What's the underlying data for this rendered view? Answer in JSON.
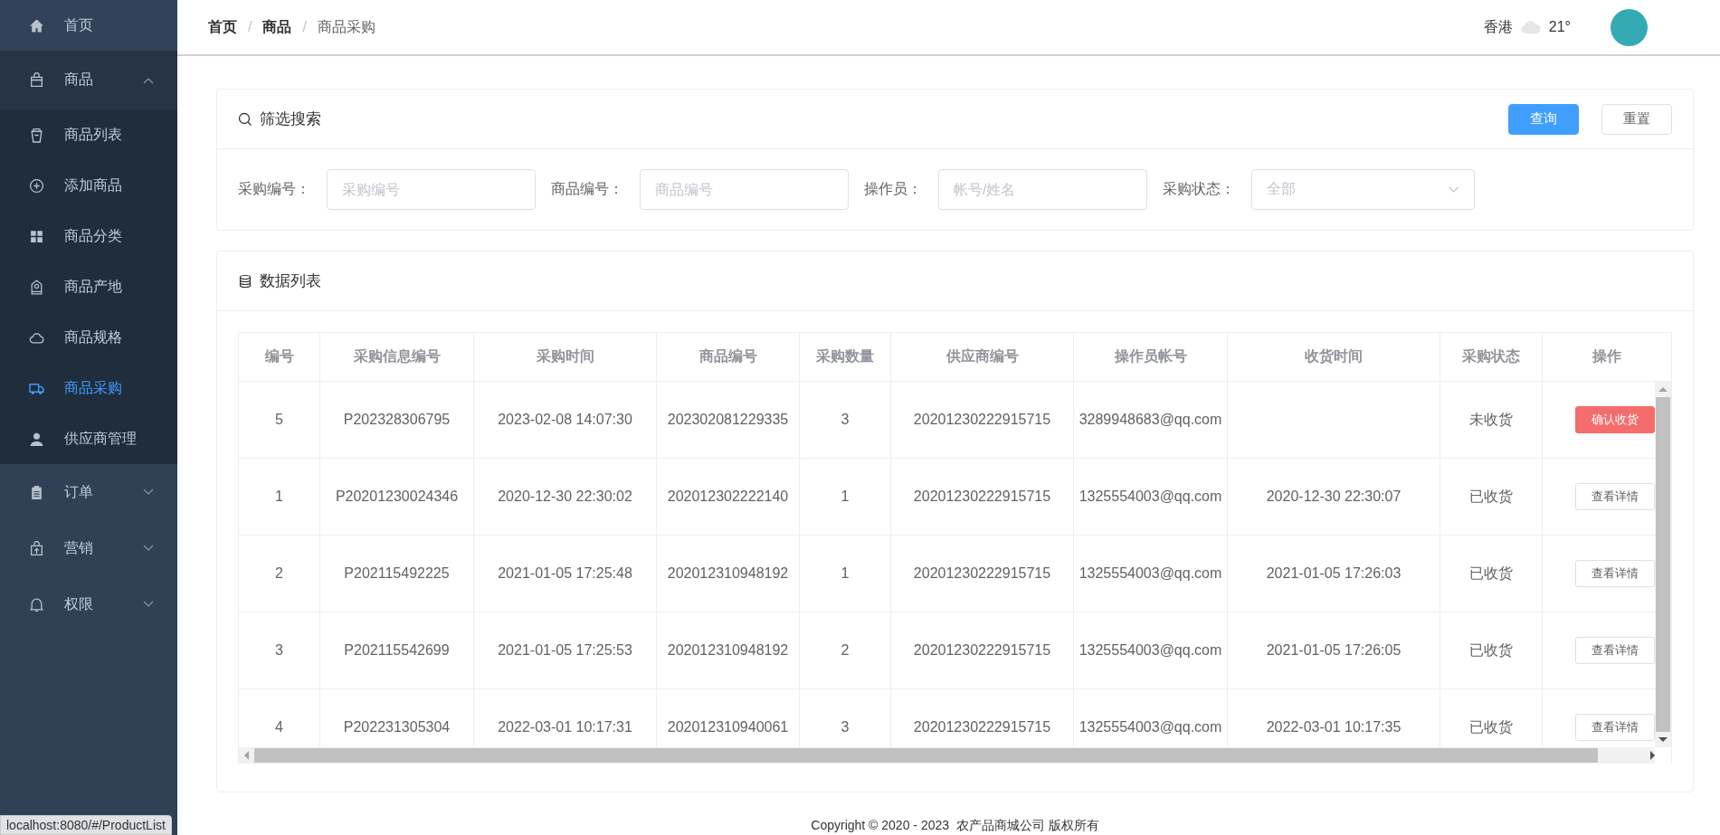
{
  "sidebar": {
    "items": [
      {
        "label": "首页",
        "selected": false
      },
      {
        "label": "商品",
        "expanded": true,
        "selected": false,
        "children": [
          {
            "label": "商品列表",
            "selected": false
          },
          {
            "label": "添加商品",
            "selected": false
          },
          {
            "label": "商品分类",
            "selected": false
          },
          {
            "label": "商品产地",
            "selected": false
          },
          {
            "label": "商品规格",
            "selected": false
          },
          {
            "label": "商品采购",
            "selected": true
          },
          {
            "label": "供应商管理",
            "selected": false
          }
        ]
      },
      {
        "label": "订单",
        "expanded": false,
        "selected": false
      },
      {
        "label": "营销",
        "expanded": false,
        "selected": false
      },
      {
        "label": "权限",
        "expanded": false,
        "selected": false
      }
    ]
  },
  "header": {
    "breadcrumb": [
      "首页",
      "商品",
      "商品采购"
    ],
    "separator": "/",
    "city": "香港",
    "temperature": "21°"
  },
  "filter": {
    "title": "筛选搜索",
    "buttons": [
      {
        "label": "查询",
        "kind": "primary"
      },
      {
        "label": "重置",
        "kind": "plain"
      }
    ],
    "fields": [
      {
        "label": "采购编号：",
        "placeholder": "采购编号",
        "kind": "input"
      },
      {
        "label": "商品编号：",
        "placeholder": "商品编号",
        "kind": "input"
      },
      {
        "label": "操作员：",
        "placeholder": "帐号/姓名",
        "kind": "input"
      },
      {
        "label": "采购状态：",
        "placeholder": "全部",
        "kind": "select"
      }
    ]
  },
  "list": {
    "title": "数据列表",
    "table": {
      "columns": [
        "编号",
        "采购信息编号",
        "采购时间",
        "商品编号",
        "采购数量",
        "供应商编号",
        "操作员帐号",
        "收货时间",
        "采购状态",
        "操作"
      ],
      "rows": [
        {
          "cells": [
            "5",
            "P202328306795",
            "2023-02-08 14:07:30",
            "202302081229335",
            "3",
            "20201230222915715",
            "3289948683@qq.com",
            "",
            "未收货"
          ],
          "action": {
            "label": "确认收货",
            "kind": "danger"
          }
        },
        {
          "cells": [
            "1",
            "P20201230024346",
            "2020-12-30 22:30:02",
            "202012302222140",
            "1",
            "20201230222915715",
            "1325554003@qq.com",
            "2020-12-30 22:30:07",
            "已收货"
          ],
          "action": {
            "label": "查看详情",
            "kind": "plain"
          }
        },
        {
          "cells": [
            "2",
            "P202115492225",
            "2021-01-05 17:25:48",
            "202012310948192",
            "1",
            "20201230222915715",
            "1325554003@qq.com",
            "2021-01-05 17:26:03",
            "已收货"
          ],
          "action": {
            "label": "查看详情",
            "kind": "plain"
          }
        },
        {
          "cells": [
            "3",
            "P202115542699",
            "2021-01-05 17:25:53",
            "202012310948192",
            "2",
            "20201230222915715",
            "1325554003@qq.com",
            "2021-01-05 17:26:05",
            "已收货"
          ],
          "action": {
            "label": "查看详情",
            "kind": "plain"
          }
        },
        {
          "cells": [
            "4",
            "P202231305304",
            "2022-03-01 10:17:31",
            "202012310940061",
            "3",
            "20201230222915715",
            "1325554003@qq.com",
            "2022-03-01 10:17:35",
            "已收货"
          ],
          "action": {
            "label": "查看详情",
            "kind": "plain"
          }
        }
      ]
    }
  },
  "footer": "Copyright © 2020 - 2023  农产品商城公司 版权所有",
  "status_url": "localhost:8080/#/ProductList"
}
